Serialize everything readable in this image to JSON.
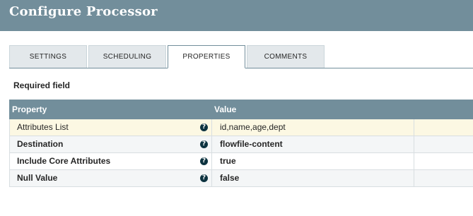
{
  "dialog": {
    "title": "Configure Processor"
  },
  "tabs": [
    {
      "label": "SETTINGS"
    },
    {
      "label": "SCHEDULING"
    },
    {
      "label": "PROPERTIES"
    },
    {
      "label": "COMMENTS"
    }
  ],
  "active_tab": "PROPERTIES",
  "required_label": "Required field",
  "grid": {
    "columns": {
      "property": "Property",
      "value": "Value"
    },
    "rows": [
      {
        "property": "Attributes List",
        "value": "id,name,age,dept",
        "required": false,
        "icon": "help-icon"
      },
      {
        "property": "Destination",
        "value": "flowfile-content",
        "required": true,
        "icon": "help-icon"
      },
      {
        "property": "Include Core Attributes",
        "value": "true",
        "required": true,
        "icon": "help-icon"
      },
      {
        "property": "Null Value",
        "value": "false",
        "required": true,
        "icon": "help-icon"
      }
    ]
  },
  "colors": {
    "header_bg": "#728e9b",
    "highlight_row": "#fcf8e3",
    "help_icon": "#0d3340"
  }
}
